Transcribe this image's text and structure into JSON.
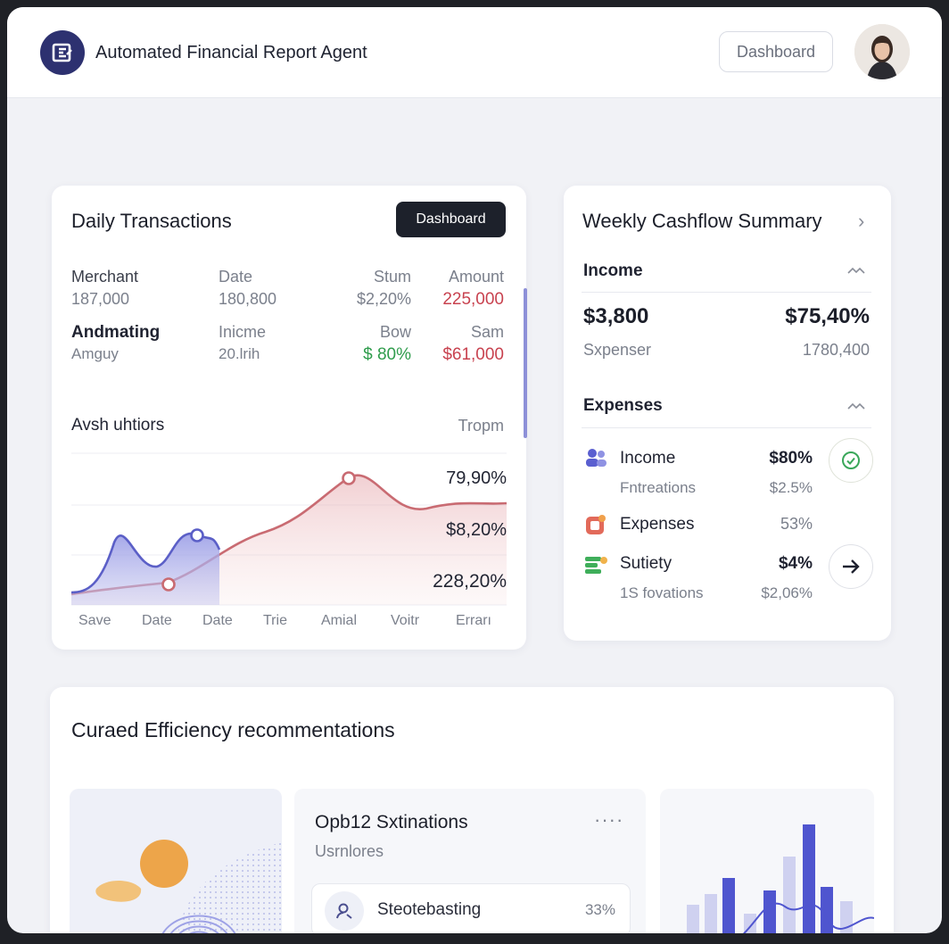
{
  "header": {
    "title": "Automated Financial Report Agent",
    "button": "Dashboard"
  },
  "daily": {
    "title": "Daily Transactions",
    "button": "Dashboard",
    "table": {
      "headers": [
        "Merchant",
        "Date",
        "Stum",
        "Amount"
      ],
      "row1": [
        "187,000",
        "180,800",
        "$2,20%",
        "225,000"
      ],
      "row2": [
        "Andmating",
        "Inicme",
        "Bow",
        "Sam"
      ],
      "row3": [
        "Amguy",
        "20.lrih",
        "$ 80%",
        "$61,000"
      ]
    },
    "chart_label": "Avsh uhtiors",
    "chart_label_right": "Tropm",
    "chart_data": {
      "type": "line",
      "x": [
        "Save",
        "Date",
        "Date",
        "Trie",
        "Amial",
        "Voitr",
        "Errarı"
      ],
      "series": [
        {
          "values": [
            0.1,
            0.55,
            0.35,
            0.58,
            0.5
          ]
        },
        {
          "values": [
            0.1,
            0.2,
            0.3,
            0.45,
            0.6,
            0.85,
            0.65,
            0.72
          ]
        }
      ],
      "value_labels": [
        "79,90%",
        "$8,20%",
        "228,20%"
      ],
      "colors": {
        "blue": "#5b5fc7",
        "red": "#c96b72"
      }
    }
  },
  "weekly": {
    "title": "Weekly Cashflow Summary",
    "income_label": "Income",
    "income_value_left": "$3,800",
    "income_value_right": "$75,40%",
    "sub_left": "Sxpenser",
    "sub_right": "1780,400",
    "expenses_label": "Expenses",
    "items": [
      {
        "name": "Income",
        "value": "$80%",
        "sub": "Fntreations",
        "sub_value": "$2.5%"
      },
      {
        "name": "Expenses",
        "value": "53%"
      },
      {
        "name": "Sutiety",
        "value": "$4%",
        "sub": "1S fovations",
        "sub_value": "$2,06%"
      }
    ]
  },
  "recs": {
    "title": "Curaed Efficiency recommentations",
    "card_title": "Opb12 Sxtinations",
    "card_sub": "Usrnlores",
    "row_label": "Steotebasting",
    "row_value": "33%"
  }
}
